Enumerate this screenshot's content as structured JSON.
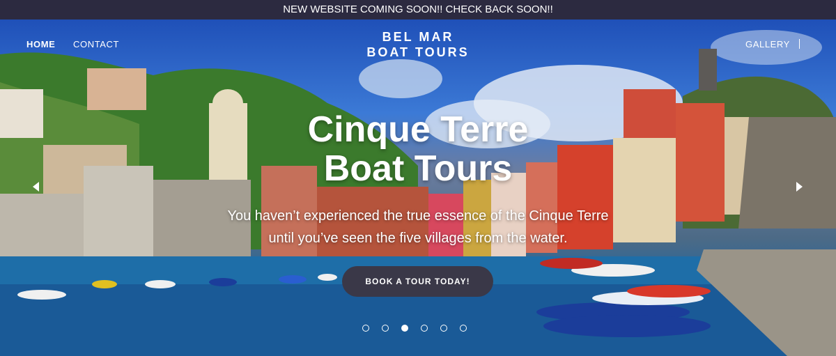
{
  "announcement": "NEW WEBSITE COMING SOON!! CHECK BACK SOON!!",
  "nav": {
    "home": "HOME",
    "contact": "CONTACT",
    "gallery": "GALLERY"
  },
  "brand": {
    "line1": "BEL MAR",
    "line2": "BOAT TOURS"
  },
  "hero": {
    "headline_line1": "Cinque Terre",
    "headline_line2": "Boat Tours",
    "subtitle_line1": "You haven’t experienced the true essence of the Cinque Terre",
    "subtitle_line2": "until you’ve seen the five villages from the water.",
    "cta": "BOOK A TOUR TODAY!"
  },
  "carousel": {
    "slide_count": 6,
    "active_index": 2,
    "prev_icon": "chevron-left-icon",
    "next_icon": "chevron-right-icon"
  },
  "colors": {
    "announcement_bg": "#2c2a40",
    "cta_bg": "#3a3848",
    "text": "#ffffff"
  }
}
